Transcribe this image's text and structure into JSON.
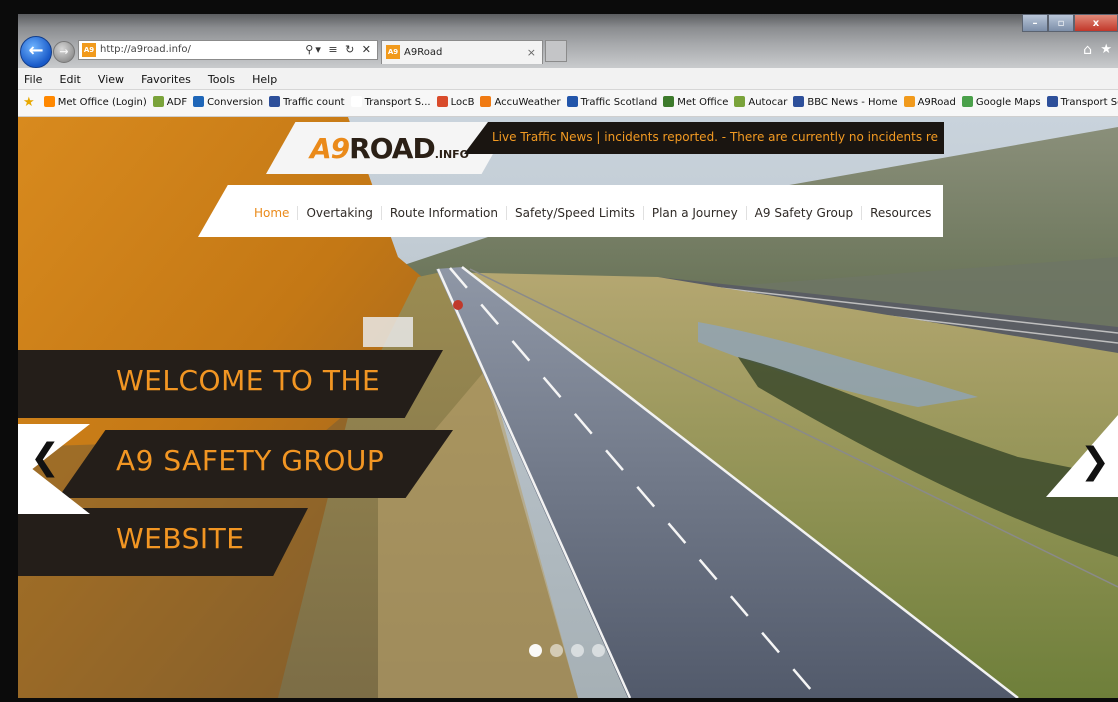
{
  "browser": {
    "address_url": "http://a9road.info/",
    "address_tools": "⚲▾ ≡ ↻ ✕",
    "tab_title": "A9Road",
    "tab_close": "×",
    "favicon_text": "A9",
    "back_glyph": "←",
    "forward_glyph": "→",
    "window_controls": {
      "minimize": "–",
      "maximize": "▫",
      "close": "x"
    },
    "home_glyph": "⌂",
    "favorites_glyph": "★"
  },
  "menu": [
    "File",
    "Edit",
    "View",
    "Favorites",
    "Tools",
    "Help"
  ],
  "favorites_bar": [
    {
      "label": "Met Office (Login)",
      "color": "#ff8800"
    },
    {
      "label": "ADF",
      "color": "#7aa33a"
    },
    {
      "label": "Conversion",
      "color": "#1e66b8"
    },
    {
      "label": "Traffic count",
      "color": "#2d4f9a"
    },
    {
      "label": "Transport S...",
      "color": "#ffffff"
    },
    {
      "label": "LocB",
      "color": "#d94b2b"
    },
    {
      "label": "AccuWeather",
      "color": "#f07a12"
    },
    {
      "label": "Traffic Scotland",
      "color": "#2255aa"
    },
    {
      "label": "Met Office",
      "color": "#3d7a2b"
    },
    {
      "label": "Autocar",
      "color": "#7aa33a"
    },
    {
      "label": "BBC News - Home",
      "color": "#2d4f9a"
    },
    {
      "label": "A9Road",
      "color": "#f19a1c"
    },
    {
      "label": "Google Maps",
      "color": "#4aa04a"
    },
    {
      "label": "Transport Scotland",
      "color": "#2d4f9a"
    }
  ],
  "site": {
    "logo_a9": "A9",
    "logo_road": "ROAD",
    "logo_info": ".INFO",
    "ticker": "Live Traffic News |  incidents reported. - There are currently no incidents re",
    "nav": [
      {
        "label": "Home",
        "active": true
      },
      {
        "label": "Overtaking"
      },
      {
        "label": "Route Information"
      },
      {
        "label": "Safety/Speed Limits"
      },
      {
        "label": "Plan a Journey"
      },
      {
        "label": "A9 Safety Group"
      },
      {
        "label": "Resources"
      }
    ],
    "welcome_lines": [
      "WELCOME TO THE",
      "A9 SAFETY GROUP",
      "WEBSITE"
    ],
    "prev_glyph": "❮",
    "next_glyph": "❯",
    "slides_count": 4,
    "active_slide": 0
  },
  "colors": {
    "accent": "#ea8a1a",
    "dark_banner": "#241e19",
    "ticker_text": "#f39a22"
  }
}
